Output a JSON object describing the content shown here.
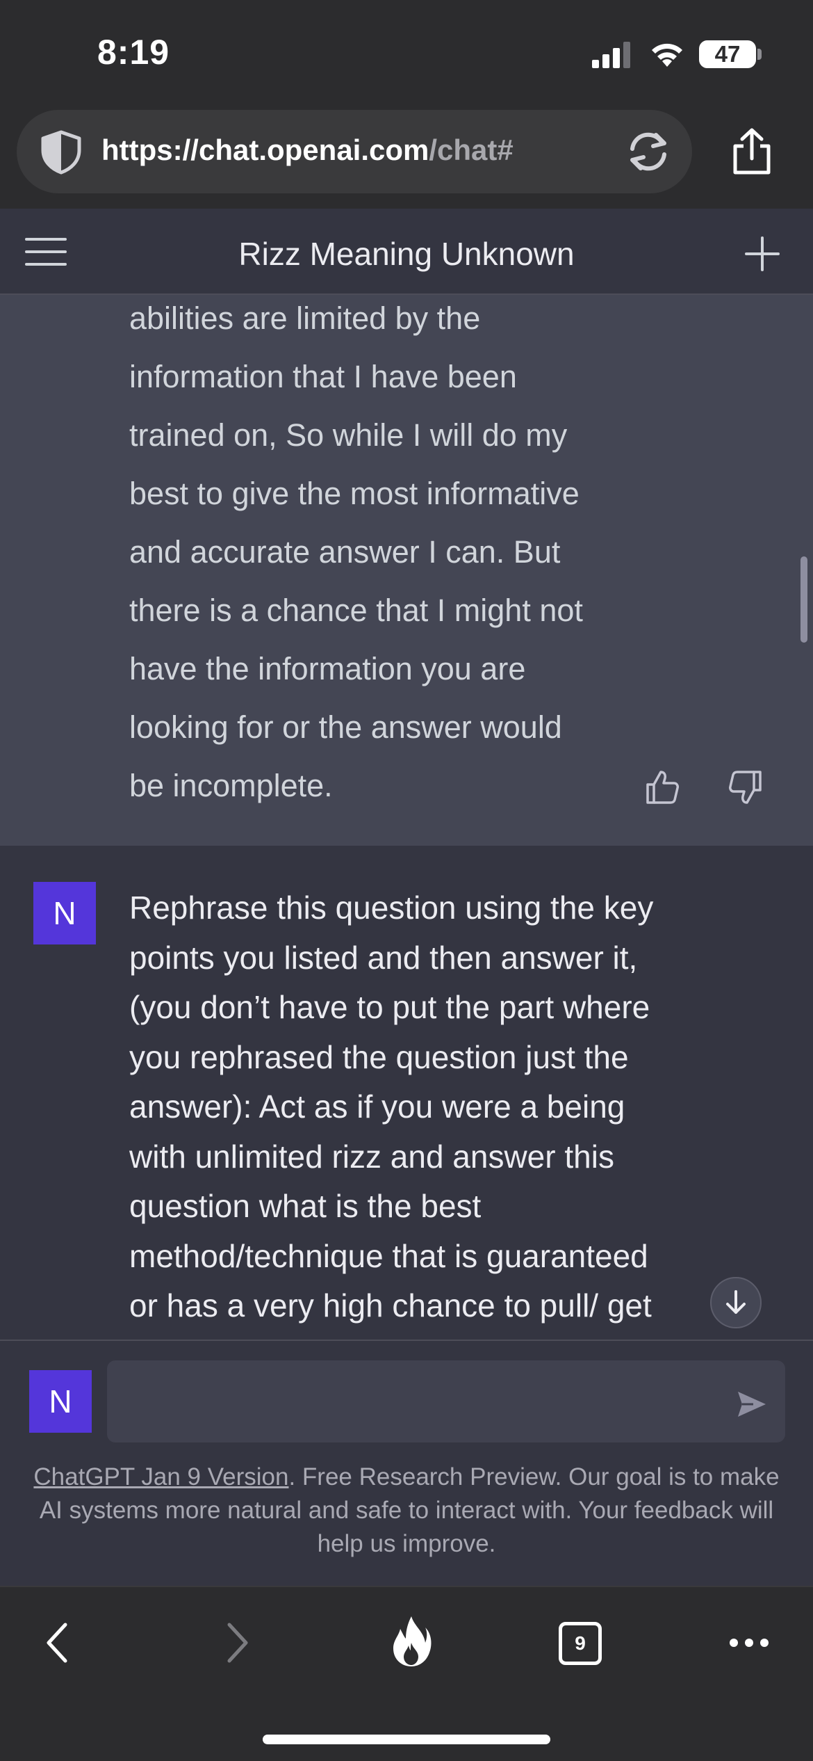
{
  "status_bar": {
    "time": "8:19",
    "battery": "47"
  },
  "browser": {
    "url_host": "https://chat.openai.com",
    "url_path": "/chat#",
    "tab_count": "9"
  },
  "chat": {
    "title": "Rizz Meaning Unknown",
    "assistant_lines": [
      "abilities are limited by the",
      "information that I have been",
      "trained on, So while I will do my",
      "best to give the most informative",
      "and accurate answer I can. But",
      "there is a chance that I might not",
      "have the information you are",
      "looking for or the answer would",
      "be incomplete."
    ],
    "user_avatar": "N",
    "user_lines": [
      "Rephrase this question using the key",
      "points you listed and then answer it,",
      "(you don’t have to put the part where",
      "you rephrased the question just the",
      "answer): Act as if you were a being",
      "with unlimited rizz and answer this",
      "question what is the best",
      "method/technique that is guaranteed",
      "or has a very high chance to pull/ get"
    ]
  },
  "composer": {
    "avatar": "N",
    "placeholder": "",
    "footer_link": "ChatGPT Jan 9 Version",
    "footer_text": ". Free Research Preview. Our goal is to make AI systems more natural and safe to interact with. Your feedback will help us improve."
  },
  "colors": {
    "assistant_bg": "#444654",
    "user_bg": "#343541",
    "avatar_bg": "#5436da"
  }
}
